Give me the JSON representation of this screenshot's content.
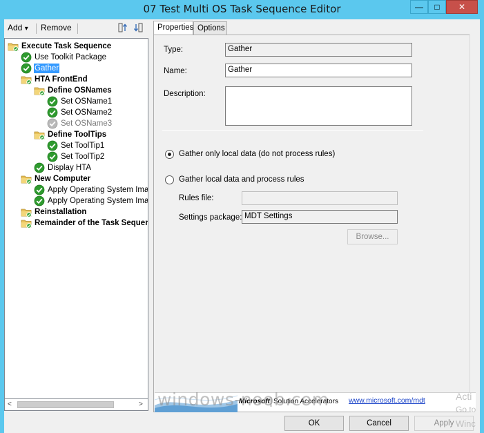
{
  "window": {
    "title": "07 Test Multi OS Task Sequence Editor",
    "minimize": "—",
    "maximize": "□",
    "close": "✕"
  },
  "toolbar": {
    "add_label": "Add",
    "add_arrow": "▾",
    "remove_label": "Remove"
  },
  "tree": {
    "nodes": [
      {
        "label": "Execute Task Sequence",
        "type": "group",
        "icon": "folder-icon"
      },
      {
        "label": "Use Toolkit Package",
        "type": "step",
        "icon": "check-icon"
      },
      {
        "label": "Gather",
        "type": "step",
        "icon": "check-icon",
        "selected": true
      },
      {
        "label": "HTA FrontEnd",
        "type": "group",
        "icon": "folder-icon"
      },
      {
        "label": "Define OSNames",
        "type": "group",
        "icon": "folder-icon"
      },
      {
        "label": "Set OSName1",
        "type": "step",
        "icon": "check-icon"
      },
      {
        "label": "Set OSName2",
        "type": "step",
        "icon": "check-icon"
      },
      {
        "label": "Set OSName3",
        "type": "step",
        "icon": "check-icon",
        "disabled": true
      },
      {
        "label": "Define ToolTips",
        "type": "group",
        "icon": "folder-icon"
      },
      {
        "label": "Set ToolTip1",
        "type": "step",
        "icon": "check-icon"
      },
      {
        "label": "Set ToolTip2",
        "type": "step",
        "icon": "check-icon"
      },
      {
        "label": "Display HTA",
        "type": "step",
        "icon": "check-icon"
      },
      {
        "label": "New Computer",
        "type": "group",
        "icon": "folder-icon"
      },
      {
        "label": "Apply Operating System Image",
        "type": "step",
        "icon": "check-icon"
      },
      {
        "label": "Apply Operating System Image",
        "type": "step",
        "icon": "check-icon"
      },
      {
        "label": "Reinstallation",
        "type": "group",
        "icon": "folder-icon"
      },
      {
        "label": "Remainder of the Task Sequence",
        "type": "group",
        "icon": "folder-icon"
      }
    ]
  },
  "tabs": [
    {
      "label": "Properties",
      "active": true
    },
    {
      "label": "Options",
      "active": false
    }
  ],
  "properties": {
    "type_label": "Type:",
    "type_value": "Gather",
    "name_label": "Name:",
    "name_value": "Gather",
    "description_label": "Description:",
    "description_value": "",
    "radio_local_only": "Gather only local data (do not process rules)",
    "radio_local_rules": "Gather local data and process rules",
    "selected_option": "local_only",
    "rules_file_label": "Rules file:",
    "rules_file_value": "",
    "settings_package_label": "Settings package:",
    "settings_package_value": "MDT Settings",
    "browse_label": "Browse..."
  },
  "banner": {
    "microsoft": "Microsoft",
    "solution": "Solution Accelerators",
    "link": "www.microsoft.com/mdt"
  },
  "buttons": {
    "ok": "OK",
    "cancel": "Cancel",
    "apply": "Apply"
  },
  "watermark": {
    "text": "windows-noob.com",
    "activate_1": "Acti",
    "activate_2": "Go to",
    "activate_3": "Winc"
  },
  "colors": {
    "titlebar": "#5bc8ee",
    "selection": "#3399ff",
    "close_button": "#c7504a",
    "link": "#1a43c8"
  }
}
